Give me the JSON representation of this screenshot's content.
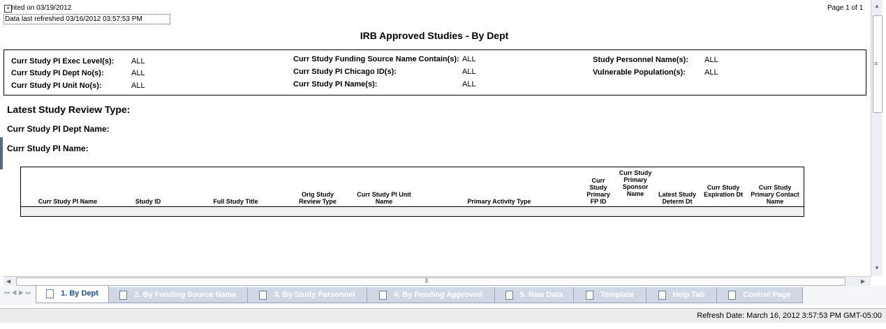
{
  "header": {
    "printed_on": "nted on 03/19/2012",
    "data_refreshed": "Data last refreshed 03/16/2012 03:57:53 PM",
    "page_indicator": "Page 1 of 1",
    "title": "IRB Approved Studies - By Dept"
  },
  "prompts": {
    "col1": [
      {
        "label": "Curr Study PI Exec Level(s):",
        "value": "ALL"
      },
      {
        "label": "Curr Study PI Dept No(s):",
        "value": "ALL"
      },
      {
        "label": "Curr Study PI Unit No(s):",
        "value": "ALL"
      }
    ],
    "col2": [
      {
        "label": "Curr Study Funding Source Name Contain(s):",
        "value": "ALL"
      },
      {
        "label": "Curr Study PI Chicago ID(s):",
        "value": "ALL"
      },
      {
        "label": "Curr Study PI Name(s):",
        "value": "ALL"
      }
    ],
    "col3": [
      {
        "label": "Study Personnel Name(s):",
        "value": "ALL"
      },
      {
        "label": "Vulnerable Population(s):",
        "value": "ALL"
      }
    ]
  },
  "sections": {
    "review_type": "Latest Study Review Type:",
    "dept_name": "Curr Study PI Dept Name:",
    "pi_name": "Curr Study PI Name:"
  },
  "table": {
    "columns": [
      "Curr Study PI Name",
      "Study ID",
      "Full Study Title",
      "Orig Study Review Type",
      "Curr Study PI Unit Name",
      "Primary Activity Type",
      "Curr Study Primary FP ID",
      "Curr Study Primary Sponsor Name",
      "Latest Study Determ Dt",
      "Curr Study Expiration Dt",
      "Curr Study Primary Contact Name"
    ]
  },
  "tabs": [
    {
      "label": "1. By Dept",
      "active": true
    },
    {
      "label": "2. By Funding Source Name",
      "active": false
    },
    {
      "label": "3. By Study Personnel",
      "active": false
    },
    {
      "label": "4. By Pending Approved",
      "active": false
    },
    {
      "label": "5. Raw Data",
      "active": false
    },
    {
      "label": "Template",
      "active": false
    },
    {
      "label": "Help Tab",
      "active": false
    },
    {
      "label": "Control Page",
      "active": false
    }
  ],
  "status": {
    "refresh": "Refresh Date: March 16, 2012 3:57:53 PM GMT-05:00"
  },
  "icons": {
    "move_handle": "move-icon",
    "tab_doc": "document-icon"
  }
}
